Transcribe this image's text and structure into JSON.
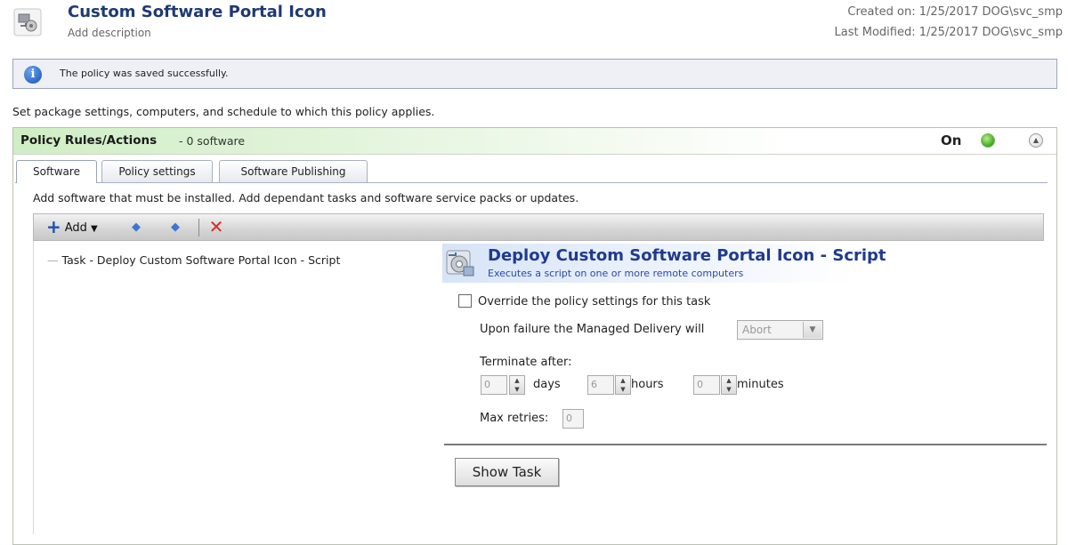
{
  "header": {
    "title": "Custom Software Portal Icon",
    "description": "Add description",
    "created": "Created on: 1/25/2017 DOG\\svc_smp",
    "modified": "Last Modified: 1/25/2017 DOG\\svc_smp"
  },
  "message": {
    "text": "The policy was saved successfully.",
    "icon": "info-icon"
  },
  "intro": "Set package settings, computers, and schedule to which this policy applies.",
  "panel": {
    "title": "Policy Rules/Actions",
    "count": "- 0 software",
    "status": "On",
    "status_color": "#3ea81a"
  },
  "tabs": [
    {
      "label": "Software",
      "active": true
    },
    {
      "label": "Policy settings",
      "active": false
    },
    {
      "label": "Software Publishing",
      "active": false
    }
  ],
  "instructions": "Add software that must be installed. Add dependant tasks and software service packs or updates.",
  "toolbar": {
    "add_label": "Add",
    "icons": [
      "plus-icon",
      "arrow-up-icon",
      "arrow-down-icon",
      "delete-icon"
    ]
  },
  "tree": {
    "items": [
      "Task - Deploy Custom Software Portal Icon - Script"
    ]
  },
  "detail": {
    "title": "Deploy Custom Software Portal Icon - Script",
    "subtitle": "Executes a script on one or more remote computers",
    "override_label": "Override the policy settings for this task",
    "override_checked": false,
    "failure_label": "Upon failure the Managed Delivery will",
    "failure_value": "Abort",
    "terminate_label": "Terminate after:",
    "days_value": "0",
    "days_label": "days",
    "hours_value": "6",
    "hours_label": "hours",
    "minutes_value": "0",
    "minutes_label": "minutes",
    "retries_label": "Max retries:",
    "retries_value": "0",
    "show_task_label": "Show Task"
  }
}
